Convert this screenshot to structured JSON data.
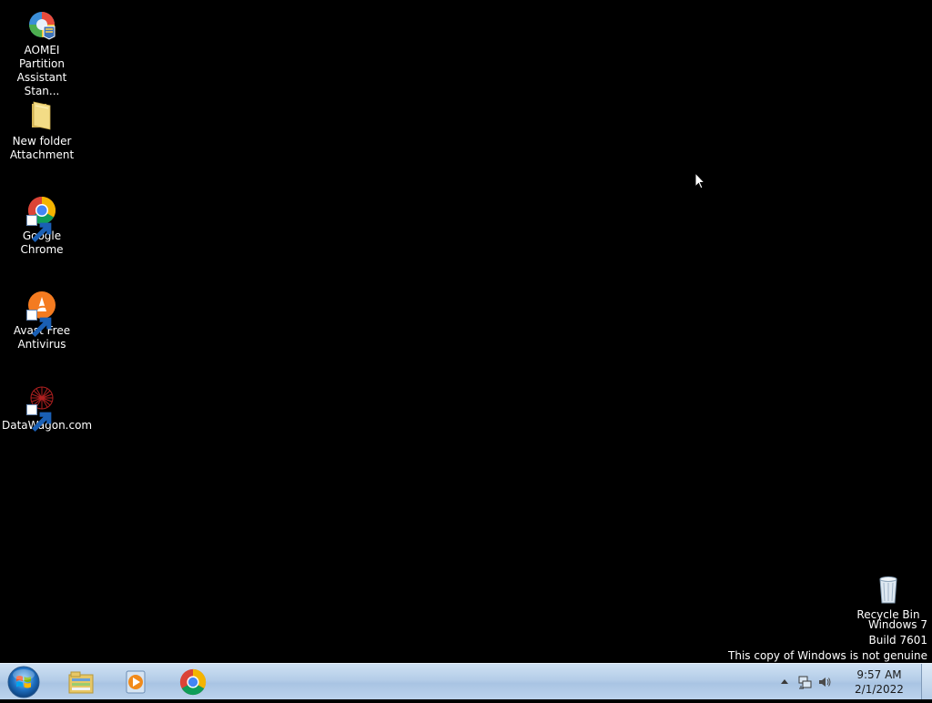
{
  "desktop": {
    "icons": [
      {
        "label": "AOMEI Partition Assistant Stan...",
        "icon": "aomei-partition-icon"
      },
      {
        "label": "New folder Attachment",
        "icon": "folder-icon"
      },
      {
        "label": "Google Chrome",
        "icon": "chrome-icon"
      },
      {
        "label": "Avast Free Antivirus",
        "icon": "avast-icon"
      },
      {
        "label": "DataWagon.com",
        "icon": "datawagon-icon"
      },
      {
        "label": "Recycle Bin",
        "icon": "recycle-bin-icon"
      }
    ],
    "watermark": {
      "line1": "Windows 7",
      "line2": "Build 7601",
      "line3": "This copy of Windows is not genuine"
    }
  },
  "taskbar": {
    "start": "start-orb-icon",
    "pinned": [
      {
        "name": "Windows Explorer",
        "icon": "explorer-icon"
      },
      {
        "name": "Windows Media Player",
        "icon": "media-player-icon"
      },
      {
        "name": "Google Chrome",
        "icon": "chrome-icon"
      }
    ],
    "tray": {
      "time": "9:57 AM",
      "date": "2/1/2022"
    }
  },
  "colors": {
    "desktop_bg": "#000000",
    "taskbar_top": "#cfe1f3",
    "taskbar_bottom": "#bcd3ec"
  }
}
